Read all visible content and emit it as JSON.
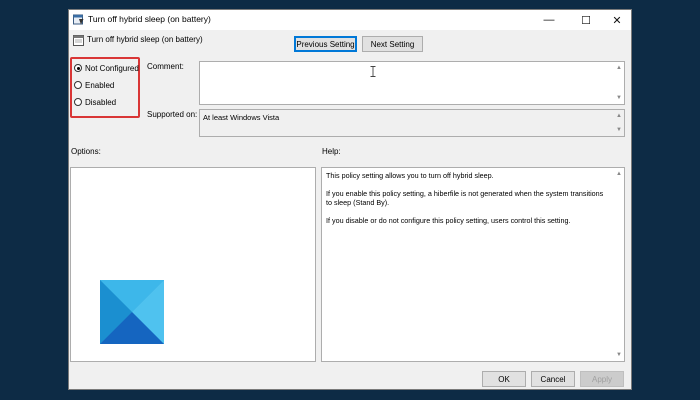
{
  "window": {
    "title": "Turn off hybrid sleep (on battery)",
    "policy_name": "Turn off hybrid sleep (on battery)",
    "controls": {
      "minimize": "—",
      "maximize": "☐",
      "close": "✕"
    }
  },
  "nav": {
    "previous": "Previous Setting",
    "next": "Next Setting"
  },
  "state": {
    "options": [
      {
        "label": "Not Configured",
        "checked": true
      },
      {
        "label": "Enabled",
        "checked": false
      },
      {
        "label": "Disabled",
        "checked": false
      }
    ],
    "highlight_color": "#d93636"
  },
  "comment": {
    "label": "Comment:",
    "value": ""
  },
  "supported": {
    "label": "Supported on:",
    "value": "At least Windows Vista"
  },
  "options_section": {
    "label": "Options:"
  },
  "help": {
    "label": "Help:",
    "paragraphs": [
      "This policy setting allows you to turn off hybrid sleep.",
      "If you enable this policy setting, a hiberfile is not generated when the system transitions to sleep (Stand By).",
      "If you disable or do not configure this policy setting, users control this setting."
    ]
  },
  "buttons": {
    "ok": "OK",
    "cancel": "Cancel",
    "apply": "Apply"
  },
  "colors": {
    "accent": "#0078d7",
    "background": "#0d2b45"
  },
  "icons": {
    "window": "policy-setting-icon",
    "logo": "windows-logo-icon",
    "cursor": "text-cursor-icon"
  }
}
